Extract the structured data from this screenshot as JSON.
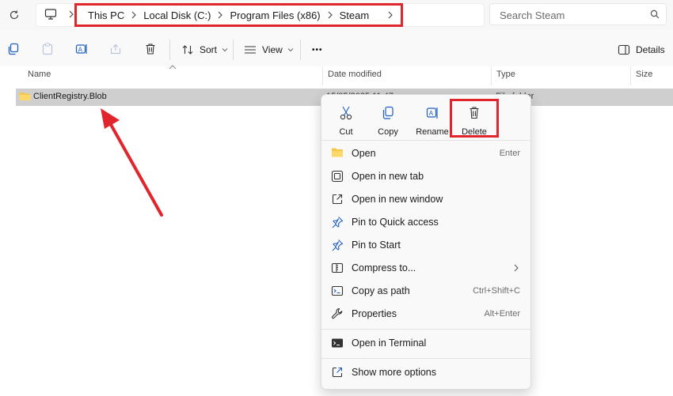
{
  "address_bar": {
    "breadcrumbs": [
      "This PC",
      "Local Disk (C:)",
      "Program Files (x86)",
      "Steam"
    ],
    "search_placeholder": "Search Steam"
  },
  "toolbar": {
    "sort_label": "Sort",
    "view_label": "View",
    "more_label": "•••",
    "details_label": "Details"
  },
  "columns": [
    "Name",
    "Date modified",
    "Type",
    "Size"
  ],
  "file_row": {
    "name": "ClientRegistry.Blob",
    "date_fragment": "15/05/2025 11:47",
    "type_fragment": "File folder"
  },
  "context_menu": {
    "quick_actions": [
      {
        "label": "Cut",
        "icon": "scissors-icon"
      },
      {
        "label": "Copy",
        "icon": "copy-icon"
      },
      {
        "label": "Rename",
        "icon": "rename-icon"
      },
      {
        "label": "Delete",
        "icon": "trash-icon"
      }
    ],
    "items": [
      {
        "label": "Open",
        "shortcut": "Enter",
        "icon": "folder-icon"
      },
      {
        "label": "Open in new tab",
        "shortcut": "",
        "icon": "new-tab-icon"
      },
      {
        "label": "Open in new window",
        "shortcut": "",
        "icon": "new-window-icon"
      },
      {
        "label": "Pin to Quick access",
        "shortcut": "",
        "icon": "pin-icon"
      },
      {
        "label": "Pin to Start",
        "shortcut": "",
        "icon": "pin-icon"
      },
      {
        "label": "Compress to...",
        "shortcut": "",
        "icon": "zip-icon"
      },
      {
        "label": "Copy as path",
        "shortcut": "Ctrl+Shift+C",
        "icon": "copy-path-icon"
      },
      {
        "label": "Properties",
        "shortcut": "Alt+Enter",
        "icon": "wrench-icon"
      },
      {
        "label": "Open in Terminal",
        "shortcut": "",
        "icon": "terminal-icon"
      },
      {
        "label": "Show more options",
        "shortcut": "",
        "icon": "more-options-icon"
      }
    ]
  },
  "annotation_color": "#e0262c"
}
